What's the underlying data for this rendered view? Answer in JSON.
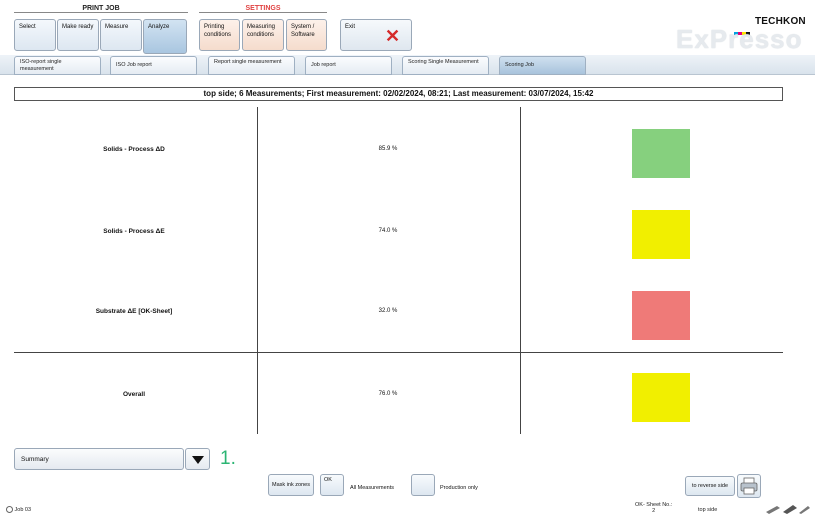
{
  "top": {
    "print_job_title": "PRINT JOB",
    "settings_title": "SETTINGS",
    "print_job_buttons": [
      {
        "label": "Select"
      },
      {
        "label": "Make ready"
      },
      {
        "label": "Measure"
      },
      {
        "label": "Analyze"
      }
    ],
    "settings_buttons": [
      {
        "label": "Printing conditions"
      },
      {
        "label": "Measuring conditions"
      },
      {
        "label": "System / Software"
      }
    ],
    "exit_label": "Exit"
  },
  "logo": {
    "brand": "TECHKON",
    "product": "ExPresso"
  },
  "tabs": [
    {
      "label": "ISO-report single measurement"
    },
    {
      "label": "ISO Job report"
    },
    {
      "label": "Report single measurement"
    },
    {
      "label": "Job report"
    },
    {
      "label": "Scoring Single Measurement"
    },
    {
      "label": "Scoring Job"
    }
  ],
  "header": "top side; 6 Measurements; First measurement: 02/02/2024, 08:21; Last measurement: 03/07/2024, 15:42",
  "rows": [
    {
      "label": "Solids - Process ΔD",
      "value": "85.9 %",
      "color": "#86d07e"
    },
    {
      "label": "Solids - Process ΔE",
      "value": "74.0 %",
      "color": "#f1ef00"
    },
    {
      "label": "Substrate ΔE [OK-Sheet]",
      "value": "32.0 %",
      "color": "#ef7a78"
    },
    {
      "label": "Overall",
      "value": "76.0 %",
      "color": "#f1ef00"
    }
  ],
  "bottom": {
    "dropdown_value": "Summary",
    "step_marker": "1.",
    "mask_ink_zones": "Mask ink zones",
    "ok_label": "OK",
    "all_measurements": "All Measurements",
    "production_only": "Production only",
    "reverse_side": "to reverse side"
  },
  "status": {
    "job": "Job 03",
    "ok_sheet_label": "OK- Sheet No.:",
    "ok_sheet_no": "2",
    "side": "top side"
  }
}
